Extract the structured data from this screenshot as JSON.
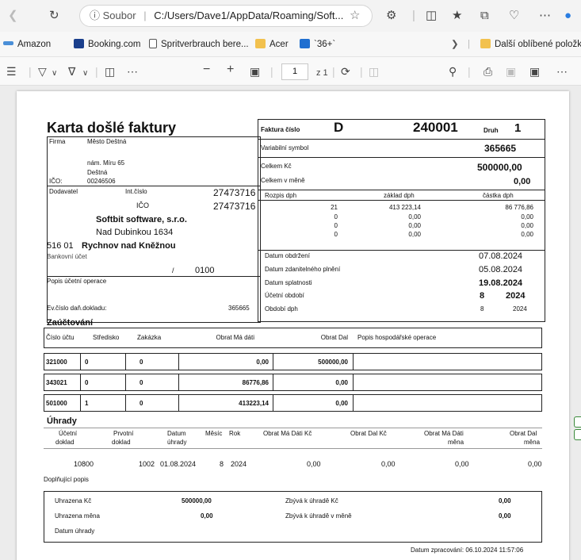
{
  "browser": {
    "url_label": "Soubor",
    "url_path": "C:/Users/Dave1/AppData/Roaming/Soft...",
    "favorites": [
      "Amazon",
      "Booking.com",
      "Spritverbrauch bere...",
      "Acer",
      "`36+`"
    ],
    "other_favorites": "Další oblíbené položky",
    "page_number": "1",
    "page_total": "z 1"
  },
  "doc": {
    "title": "Karta došlé faktury",
    "firma_label": "Firma",
    "firma_name": "Město Deštná",
    "firma_street": "nám. Míru 65",
    "firma_city": "Deštná",
    "ico_label": "IČO:",
    "ico_value": "00246506",
    "dodavatel_label": "Dodavatel",
    "int_cislo_label": "Int.číslo",
    "int_cislo_value": "27473716",
    "ico2_label": "IČO",
    "ico2_value": "27473716",
    "supplier_name": "Softbit software, s.r.o.",
    "supplier_street": "Nad Dubinkou 1634",
    "supplier_zip": "516 01",
    "supplier_city": "Rychnov nad Kněžnou",
    "bank_label": "Bankovní účet",
    "bank_slash": "/",
    "bank_code": "0100",
    "popis_label": "Popis účetní operace",
    "ev_label": "Ev.číslo daň.dokladu:",
    "ev_value": "365665",
    "faktura_label": "Faktura číslo",
    "faktura_series": "D",
    "faktura_number": "240001",
    "druh_label": "Druh",
    "druh_value": "1",
    "vs_label": "Variabilní symbol",
    "vs_value": "365665",
    "celkem_label": "Celkem Kč",
    "celkem_value": "500000,00",
    "celkem_mene_label": "Celkem v měně",
    "celkem_mene_value": "0,00",
    "rozpis_label": "Rozpis dph",
    "zaklad_label": "základ dph",
    "castka_label": "částka dph",
    "vat_rows": [
      {
        "rate": "21",
        "base": "413 223,14",
        "amount": "86 776,86"
      },
      {
        "rate": "0",
        "base": "0,00",
        "amount": "0,00"
      },
      {
        "rate": "0",
        "base": "0,00",
        "amount": "0,00"
      },
      {
        "rate": "0",
        "base": "0,00",
        "amount": "0,00"
      }
    ],
    "datum_obdrzeni_label": "Datum obdržení",
    "datum_obdrzeni_value": "07.08.2024",
    "datum_zdan_label": "Datum zdanitelného plnění",
    "datum_zdan_value": "05.08.2024",
    "datum_splat_label": "Datum splatnosti",
    "datum_splat_value": "19.08.2024",
    "ucetni_obdobi_label": "Účetní období",
    "ucetni_obdobi_month": "8",
    "ucetni_obdobi_year": "2024",
    "obdobi_dph_label": "Období dph",
    "obdobi_dph_month": "8",
    "obdobi_dph_year": "2024",
    "zauctovani_title": "Zaúčtování",
    "zauct_headers": [
      "Číslo účtu",
      "Středisko",
      "Zakázka",
      "Obrat Má dáti",
      "Obrat Dal",
      "Popis hospodářské operace"
    ],
    "zauct_rows": [
      {
        "ucet": "321000",
        "stredisko": "0",
        "zakazka": "0",
        "md": "0,00",
        "dal": "500000,00"
      },
      {
        "ucet": "343021",
        "stredisko": "0",
        "zakazka": "0",
        "md": "86776,86",
        "dal": "0,00"
      },
      {
        "ucet": "501000",
        "stredisko": "1",
        "zakazka": "0",
        "md": "413223,14",
        "dal": "0,00"
      }
    ],
    "uhrady_title": "Úhrady",
    "uhrady_headers": {
      "ucetni": [
        "Účetní",
        "doklad"
      ],
      "prvotni": [
        "Prvotní",
        "doklad"
      ],
      "datum": [
        "Datum",
        "úhrady"
      ],
      "mesic": "Měsíc",
      "rok": "Rok",
      "md_kc": "Obrat Má Dáti Kč",
      "dal_kc": "Obrat Dal Kč",
      "md_mena": [
        "Obrat Má Dáti",
        "měna"
      ],
      "dal_mena": [
        "Obrat Dal",
        "měna"
      ]
    },
    "uhrady_row": {
      "ucetni": "10800",
      "prvotni": "1002",
      "datum": "01.08.2024",
      "mesic": "8",
      "rok": "2024",
      "md_kc": "0,00",
      "dal_kc": "0,00",
      "md_mena": "0,00",
      "dal_mena": "0,00"
    },
    "doplnujici_label": "Doplňující popis",
    "uhrazena_kc_label": "Uhrazena Kč",
    "uhrazena_kc_value": "500000,00",
    "zbyva_kc_label": "Zbývá k úhradě Kč",
    "zbyva_kc_value": "0,00",
    "uhrazena_mena_label": "Uhrazena měna",
    "uhrazena_mena_value": "0,00",
    "zbyva_mena_label": "Zbývá k úhradě v měně",
    "zbyva_mena_value": "0,00",
    "datum_uhrady_label": "Datum úhrady",
    "zpracovani": "Datum zpracování: 06.10.2024 11:57:06"
  }
}
